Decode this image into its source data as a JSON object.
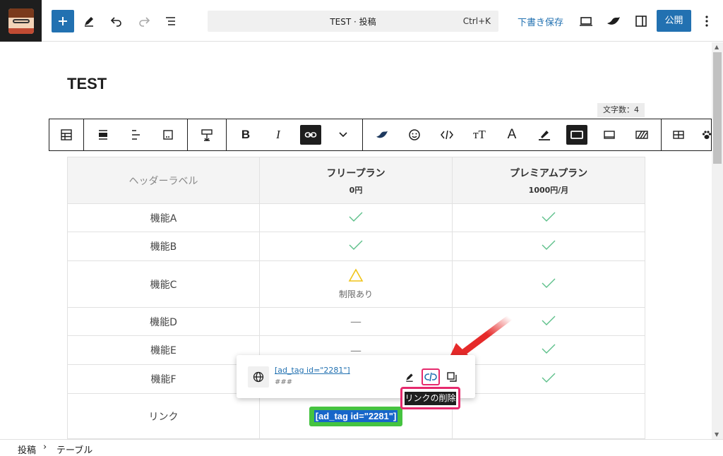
{
  "topbar": {
    "add_label": "+",
    "document_title": "TEST · 投稿",
    "shortcut": "Ctrl+K",
    "save_draft": "下書き保存",
    "publish": "公開"
  },
  "post": {
    "title": "TEST",
    "char_count": "文字数：4"
  },
  "table": {
    "header_label": "ヘッダーラベル",
    "plans": [
      {
        "name": "フリープラン",
        "price": "0円"
      },
      {
        "name": "プレミアムプラン",
        "price": "1000円/月"
      }
    ],
    "rows": [
      {
        "feature": "機能A",
        "free": "check",
        "premium": "check"
      },
      {
        "feature": "機能B",
        "free": "check",
        "premium": "check"
      },
      {
        "feature": "機能C",
        "free": "triangle",
        "free_note": "制限あり",
        "premium": "check"
      },
      {
        "feature": "機能D",
        "free": "—",
        "premium": "check"
      },
      {
        "feature": "機能E",
        "free": "—",
        "premium": "check"
      },
      {
        "feature": "機能F",
        "free": "",
        "premium": "check"
      }
    ],
    "link_row": {
      "label": "リンク",
      "button_text": "[ad_tag id=\"2281\"]"
    }
  },
  "link_popover": {
    "url": "[ad_tag id=\"2281\"]",
    "subtext": "###",
    "tooltip": "リンクの削除"
  },
  "breadcrumb": {
    "item1": "投稿",
    "sep": "›",
    "item2": "テーブル"
  },
  "colors": {
    "accent": "#2271b1",
    "check": "#5dc08a",
    "warning": "#f0c419",
    "highlight": "#e62a6d",
    "link_button": "#45c340"
  }
}
